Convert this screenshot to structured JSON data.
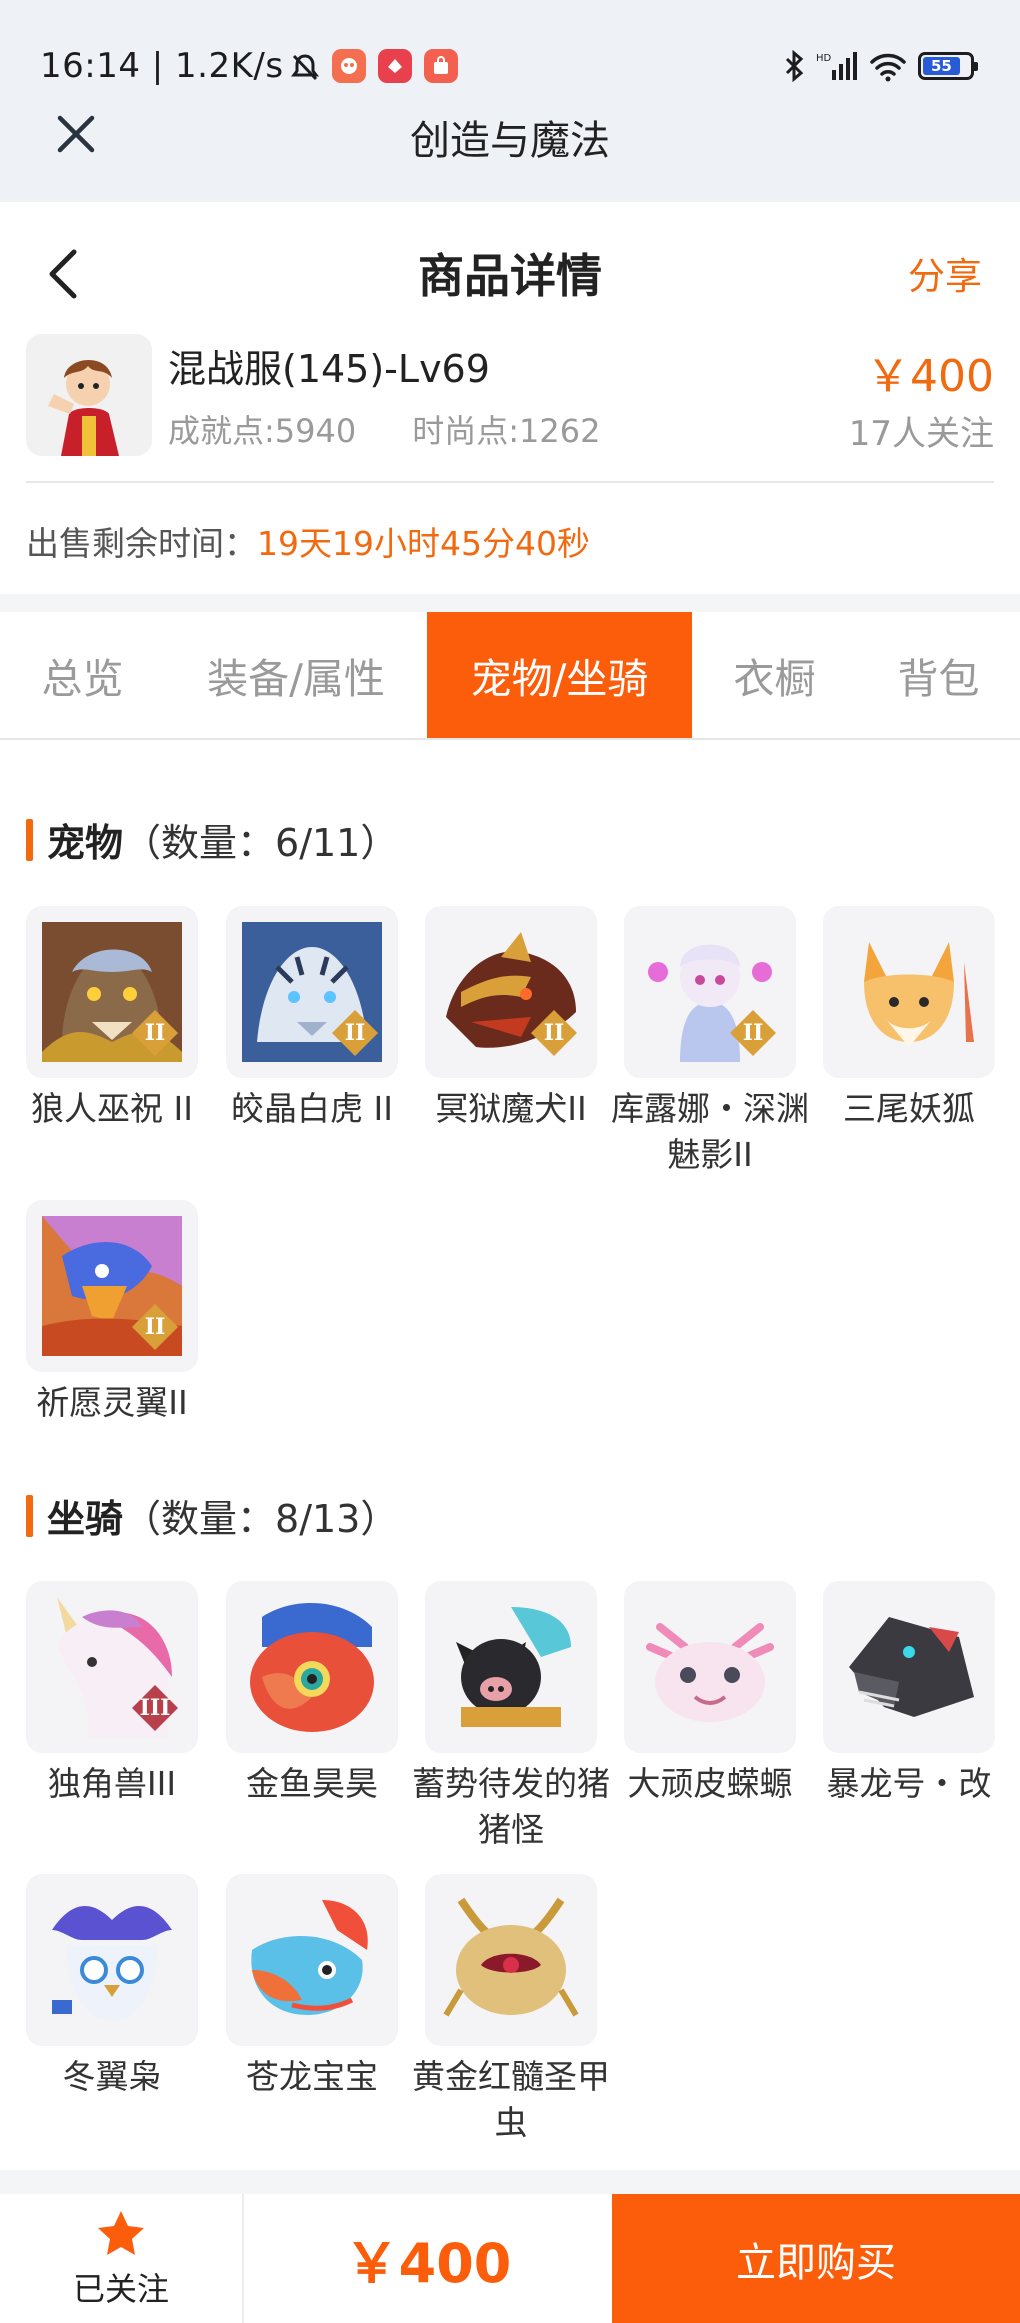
{
  "status_bar": {
    "time_speed": "16:14 | 1.2K/s",
    "battery": "55"
  },
  "app_bar": {
    "title": "创造与魔法"
  },
  "header": {
    "title": "商品详情",
    "share": "分享"
  },
  "product": {
    "name": "混战服(145)-Lv69",
    "achievement": "成就点:5940",
    "fashion": "时尚点:1262",
    "price": "￥400",
    "followers": "17人关注"
  },
  "sale": {
    "label": "出售剩余时间：",
    "time": "19天19小时45分40秒"
  },
  "tabs": [
    {
      "label": "总览"
    },
    {
      "label": "装备/属性"
    },
    {
      "label": "宠物/坐骑"
    },
    {
      "label": "衣橱"
    },
    {
      "label": "背包"
    }
  ],
  "active_tab": "宠物/坐骑",
  "pets": {
    "title": "宠物",
    "count": "（数量：6/11）",
    "items": [
      {
        "name": "狼人巫祝 II",
        "badge": "II",
        "icon": "werewolf-pet-icon"
      },
      {
        "name": "皎晶白虎 II",
        "badge": "II",
        "icon": "white-tiger-pet-icon"
      },
      {
        "name": "冥狱魔犬II",
        "badge": "II",
        "icon": "hellhound-pet-icon"
      },
      {
        "name": "库露娜・深渊魅影II",
        "badge": "II",
        "icon": "kuluna-pet-icon"
      },
      {
        "name": "三尾妖狐",
        "badge": "",
        "icon": "three-tailed-fox-pet-icon"
      },
      {
        "name": "祈愿灵翼II",
        "badge": "II",
        "icon": "spirit-wing-pet-icon"
      }
    ]
  },
  "mounts": {
    "title": "坐骑",
    "count": "（数量：8/13）",
    "items": [
      {
        "name": "独角兽III",
        "badge": "III",
        "icon": "unicorn-mount-icon"
      },
      {
        "name": "金鱼昊昊",
        "badge": "",
        "icon": "goldfish-mount-icon"
      },
      {
        "name": "蓄势待发的猪猪怪",
        "badge": "",
        "icon": "pig-monster-mount-icon"
      },
      {
        "name": "大顽皮蝾螈",
        "badge": "",
        "icon": "axolotl-mount-icon"
      },
      {
        "name": "暴龙号・改",
        "badge": "",
        "icon": "mecha-dragon-mount-icon"
      },
      {
        "name": "冬翼枭",
        "badge": "",
        "icon": "winter-owl-mount-icon"
      },
      {
        "name": "苍龙宝宝",
        "badge": "",
        "icon": "azure-dragon-mount-icon"
      },
      {
        "name": "黄金红髓圣甲虫",
        "badge": "",
        "icon": "golden-scarab-mount-icon"
      }
    ]
  },
  "bottom_bar": {
    "follow": "已关注",
    "price": "￥400",
    "buy": "立即购买"
  },
  "colors": {
    "accent": "#fb5d0b",
    "accent_text": "#f26a10",
    "badge_gold": "#d9a03a",
    "badge_red": "#b8404a"
  }
}
